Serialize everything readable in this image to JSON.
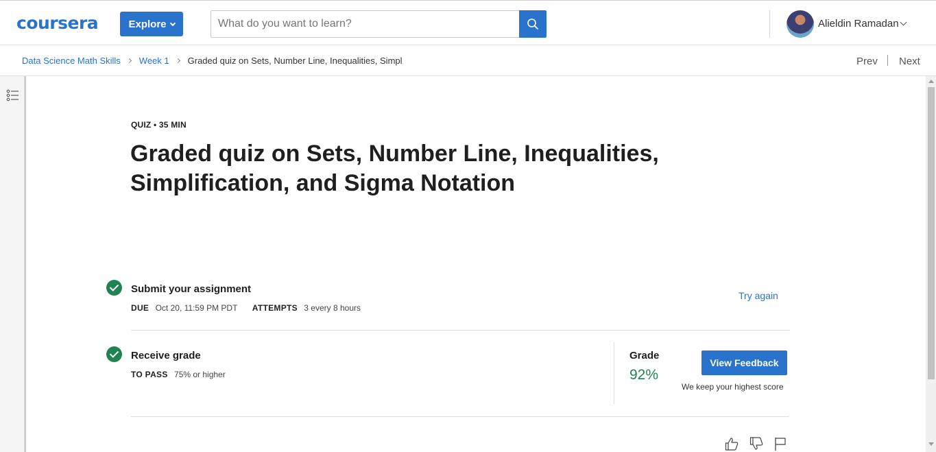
{
  "header": {
    "logo_text": "coursera",
    "explore_label": "Explore",
    "search_placeholder": "What do you want to learn?",
    "user_name": "Alieldin Ramadan"
  },
  "breadcrumb": {
    "items": [
      "Data Science Math Skills",
      "Week 1"
    ],
    "current": "Graded quiz on Sets, Number Line, Inequalities, Simpl"
  },
  "pager": {
    "prev": "Prev",
    "next": "Next"
  },
  "quiz": {
    "meta": "QUIZ • 35 MIN",
    "title": "Graded quiz on Sets, Number Line, Inequalities, Simplification, and Sigma Notation",
    "submit": {
      "title": "Submit your assignment",
      "due_label": "DUE",
      "due_value": "Oct 20, 11:59 PM PDT",
      "attempts_label": "ATTEMPTS",
      "attempts_value": "3 every 8 hours",
      "action": "Try again"
    },
    "receive": {
      "title": "Receive grade",
      "pass_label": "TO PASS",
      "pass_value": "75% or higher",
      "grade_label": "Grade",
      "grade_value": "92%",
      "feedback_button": "View Feedback",
      "keep_note": "We keep your highest score"
    }
  },
  "colors": {
    "brand": "#2a73cc",
    "success": "#1f8354"
  },
  "icons": [
    "search-icon",
    "toc-icon",
    "thumbs-up-icon",
    "thumbs-down-icon",
    "flag-icon",
    "check-circle-icon"
  ]
}
